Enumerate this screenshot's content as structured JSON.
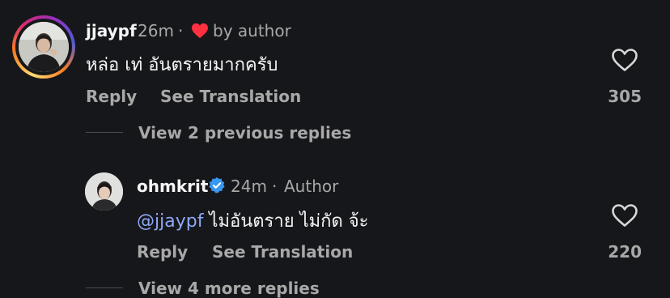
{
  "comment1": {
    "username": "jjaypf",
    "time": "26m",
    "separator": "·",
    "liked_by_author": "by author",
    "text": "หล่อ เท่ อันตรายมากครับ",
    "reply_label": "Reply",
    "see_translation_label": "See Translation",
    "likes": "305"
  },
  "view_previous": "View 2 previous replies",
  "reply1": {
    "username": "ohmkrit",
    "time": "24m",
    "separator": "·",
    "author_tag": "Author",
    "mention": "@jjaypf",
    "text": " ไม่อันตราย ไม่กัด จ้ะ",
    "reply_label": "Reply",
    "see_translation_label": "See Translation",
    "likes": "220"
  },
  "view_more": "View 4 more replies",
  "colors": {
    "background": "#16171a",
    "heart": "#ff3040",
    "mention": "#8ea8f5",
    "verified": "#3897f0"
  },
  "icons": {
    "like": "heart-outline-icon",
    "liked_by_author": "heart-filled-icon",
    "verified": "verified-badge-icon"
  }
}
